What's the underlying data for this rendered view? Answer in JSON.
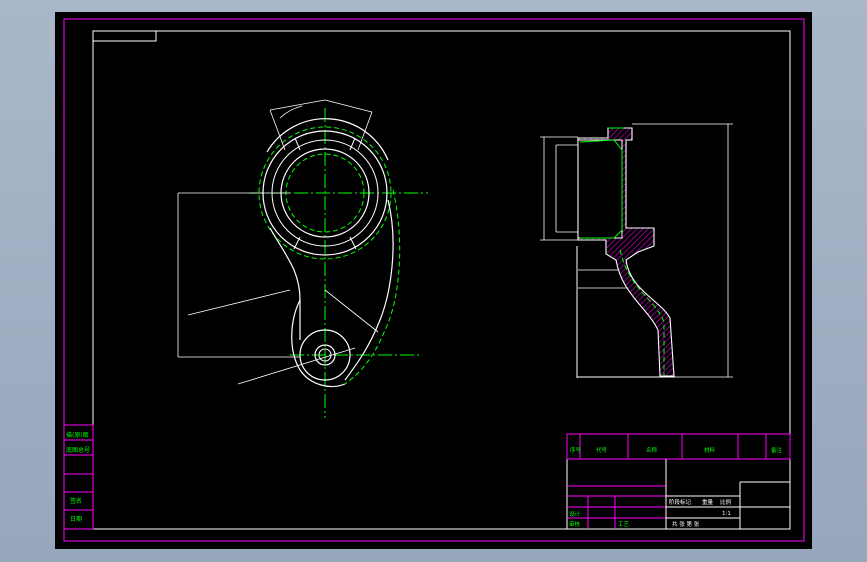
{
  "colors": {
    "background": "#000000",
    "frame": "#ff00ff",
    "part_outline": "#ffffff",
    "center_line": "#00ff00",
    "hidden_line": "#00ff00",
    "title_text": "#00ff00",
    "viewport": "#a3b1c4"
  },
  "side_panel": {
    "rows": [
      "描(原)图",
      "底图总号",
      "签名",
      "日期"
    ]
  },
  "title_block": {
    "header": [
      "序号",
      "代号",
      "名称",
      "材料",
      "备注"
    ],
    "row_labels": [
      "设计",
      "审核",
      "工艺"
    ],
    "stage_labels": [
      "阶段标记",
      "重量",
      "比例"
    ],
    "scale": "1:1",
    "sheet_text": "共 张 第 张"
  }
}
